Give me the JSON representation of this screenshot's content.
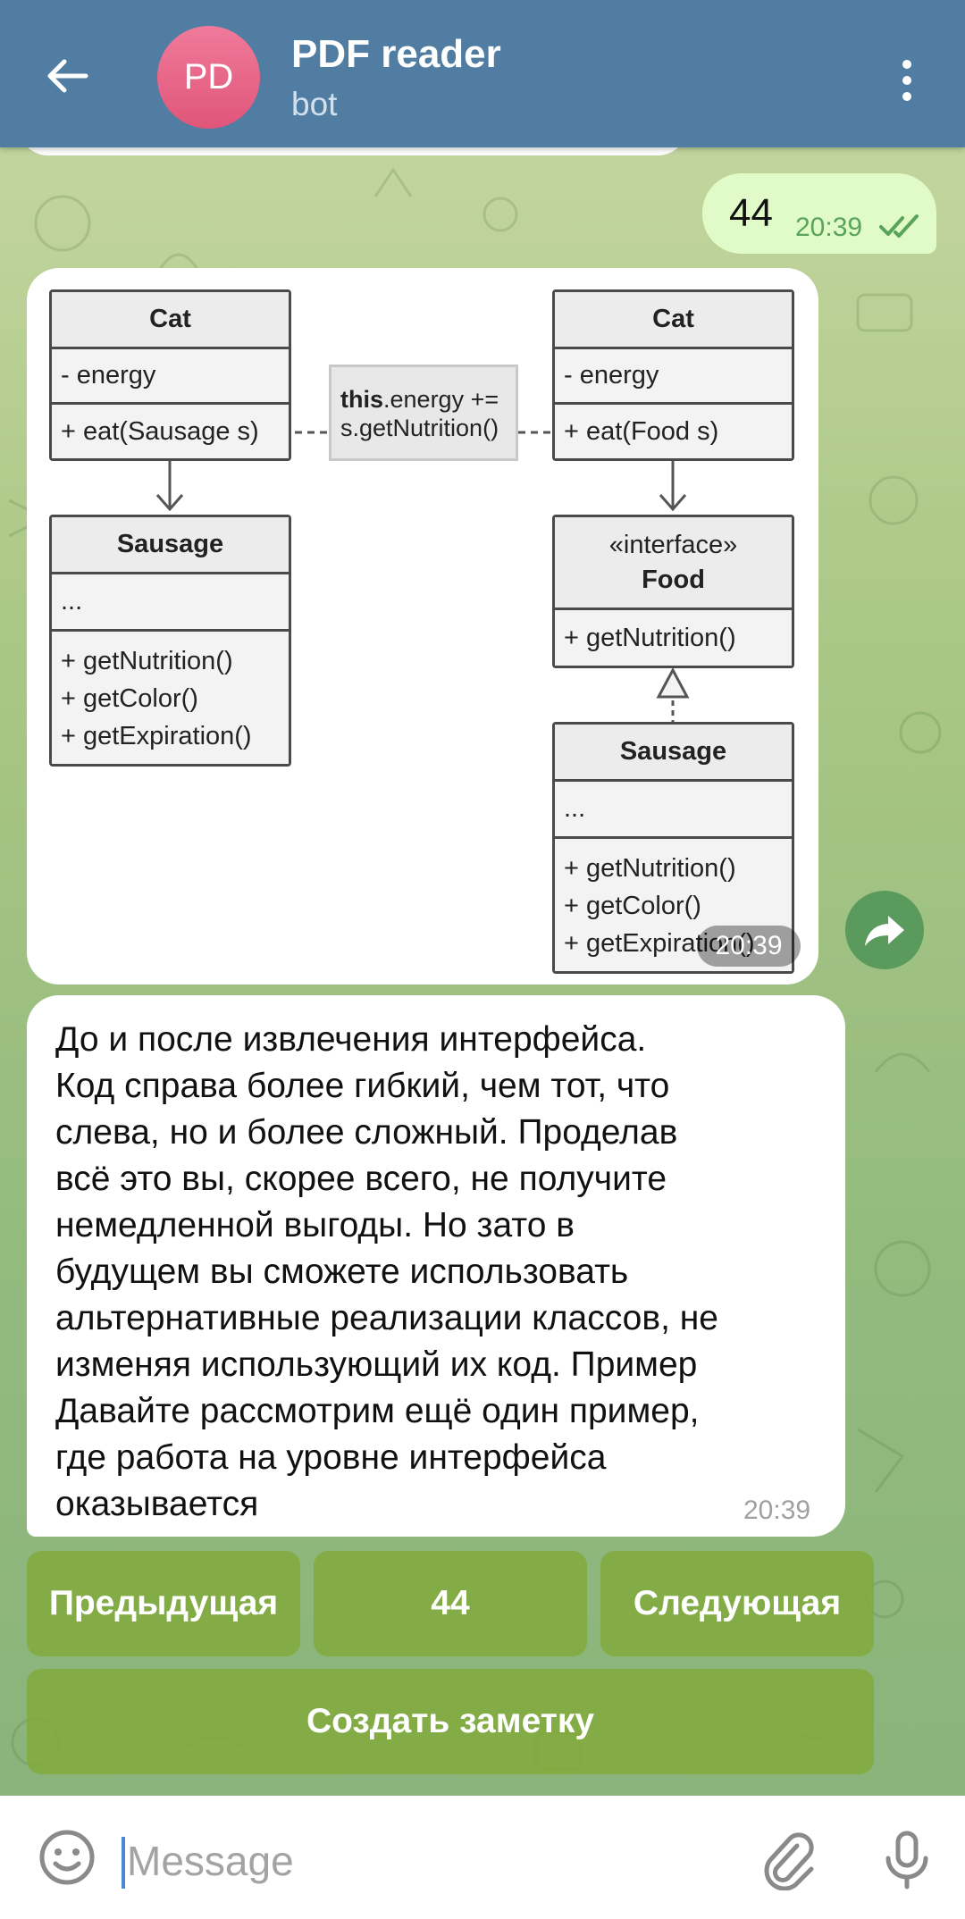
{
  "header": {
    "avatar_initials": "PD",
    "title": "PDF reader",
    "subtitle": "bot"
  },
  "outgoing": {
    "text": "44",
    "time": "20:39",
    "status": "read"
  },
  "image_message": {
    "time": "20:39",
    "diagram": {
      "left": {
        "cat": {
          "name": "Cat",
          "fields": [
            "- energy"
          ],
          "methods": [
            "+ eat(Sausage s)"
          ]
        },
        "sausage": {
          "name": "Sausage",
          "fields": [
            "..."
          ],
          "methods": [
            "+ getNutrition()",
            "+ getColor()",
            "+ getExpiration()"
          ]
        }
      },
      "note": {
        "bold": "this",
        "line1_rest": ".energy +=",
        "line2": "s.getNutrition()"
      },
      "right": {
        "cat": {
          "name": "Cat",
          "fields": [
            "- energy"
          ],
          "methods": [
            "+ eat(Food s)"
          ]
        },
        "food": {
          "stereotype": "«interface»",
          "name": "Food",
          "methods": [
            "+ getNutrition()"
          ]
        },
        "sausage": {
          "name": "Sausage",
          "fields": [
            "..."
          ],
          "methods": [
            "+ getNutrition()",
            "+ getColor()",
            "+ getExpiration()"
          ]
        }
      }
    }
  },
  "text_message": {
    "lines": [
      "До и после извлечения интерфейса.",
      "Код справа более гибкий, чем тот, что",
      "слева, но и более сложный. Проделав",
      "всё это вы, скорее всего, не получите",
      "немедленной выгоды. Но зато в",
      "будущем вы сможете использовать",
      "альтернативные реализации классов, не",
      "изменяя использующий их код. Пример",
      "Давайте рассмотрим ещё один пример,",
      "где работа на уровне интерфейса",
      "оказывается"
    ],
    "time": "20:39"
  },
  "keyboard": {
    "prev": "Предыдущая",
    "page": "44",
    "next": "Следующая",
    "note": "Создать заметку"
  },
  "input": {
    "placeholder": "Message"
  },
  "icons": {
    "back": "arrow-left-icon",
    "more": "more-vertical-icon",
    "forward": "forward-icon",
    "emoji": "emoji-icon",
    "attach": "paperclip-icon",
    "mic": "microphone-icon",
    "read": "double-check-icon"
  },
  "colors": {
    "header": "#527da3",
    "outgoing_bubble": "#e0fbc7",
    "keyboard_button": "#82aa3c",
    "avatar": "#e8688a"
  }
}
